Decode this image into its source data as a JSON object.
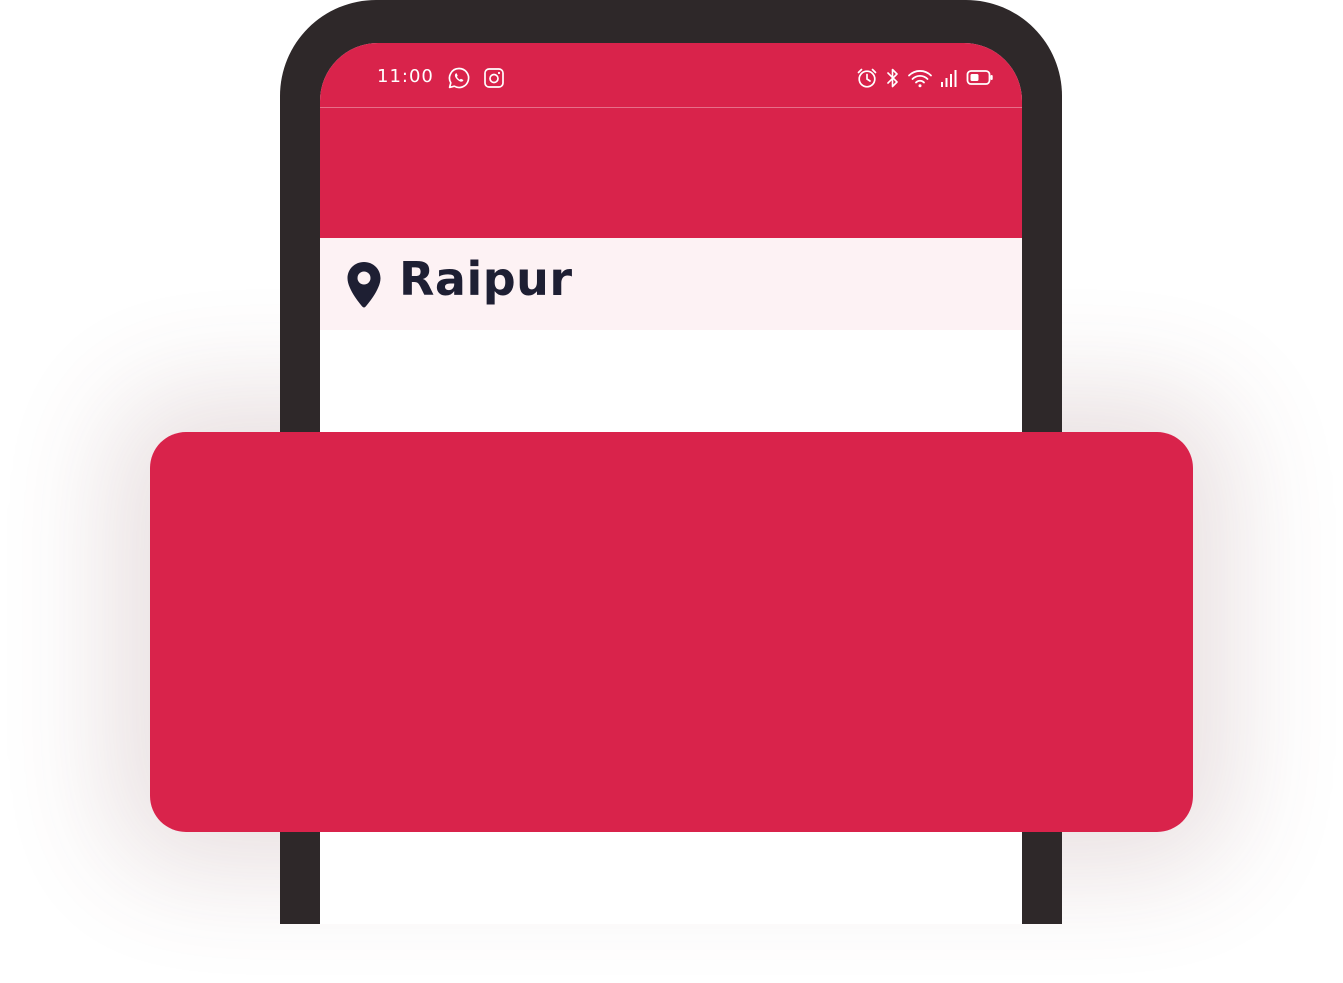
{
  "colors": {
    "accent": "#d9234b",
    "frame": "#2e2829",
    "location_bar_bg": "#fdf2f4",
    "text_dark": "#1e1f33"
  },
  "status_bar": {
    "time": "11:00",
    "left_icons": [
      "whatsapp-icon",
      "instagram-icon"
    ],
    "right_icons": [
      "alarm-icon",
      "bluetooth-icon",
      "wifi-icon",
      "signal-icon",
      "battery-icon"
    ]
  },
  "location": {
    "icon": "map-pin-icon",
    "name": "Raipur"
  }
}
